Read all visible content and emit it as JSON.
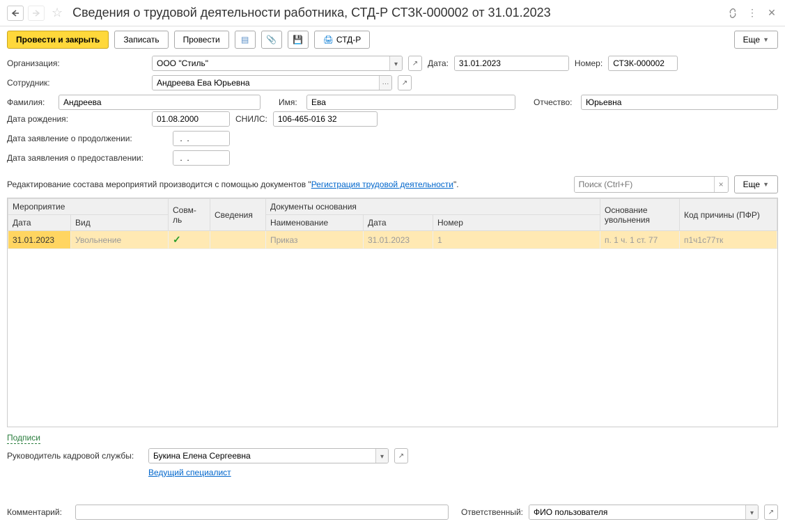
{
  "header": {
    "title": "Сведения о трудовой деятельности работника, СТД-Р СТЗК-000002 от 31.01.2023"
  },
  "toolbar": {
    "post_and_close": "Провести и закрыть",
    "save": "Записать",
    "post": "Провести",
    "std_r": "СТД-Р",
    "more": "Еще"
  },
  "fields": {
    "org_label": "Организация:",
    "org_value": "ООО \"Стиль\"",
    "date_label": "Дата:",
    "date_value": "31.01.2023",
    "number_label": "Номер:",
    "number_value": "СТЗК-000002",
    "employee_label": "Сотрудник:",
    "employee_value": "Андреева Ева Юрьевна",
    "lastname_label": "Фамилия:",
    "lastname_value": "Андреева",
    "firstname_label": "Имя:",
    "firstname_value": "Ева",
    "middlename_label": "Отчество:",
    "middlename_value": "Юрьевна",
    "birthdate_label": "Дата рождения:",
    "birthdate_value": "01.08.2000",
    "snils_label": "СНИЛС:",
    "snils_value": "106-465-016 32",
    "continue_label": "Дата заявление о продолжении:",
    "continue_value": " .  .    ",
    "provide_label": "Дата заявления о предоставлении:",
    "provide_value": " .  .    "
  },
  "hint": {
    "text_prefix": "Редактирование состава мероприятий производится с помощью документов \"",
    "link": "Регистрация трудовой деятельности",
    "text_suffix": "\".",
    "search_placeholder": "Поиск (Ctrl+F)",
    "more": "Еще"
  },
  "table": {
    "headers": {
      "event": "Мероприятие",
      "date": "Дата",
      "type": "Вид",
      "combine": "Совм-ль",
      "info": "Сведения",
      "docs": "Документы основания",
      "doc_name": "Наименование",
      "doc_date": "Дата",
      "doc_number": "Номер",
      "dismissal_basis": "Основание увольнения",
      "reason_code": "Код причины (ПФР)"
    },
    "rows": [
      {
        "date": "31.01.2023",
        "type": "Увольнение",
        "combine": "✓",
        "info": "",
        "doc_name": "Приказ",
        "doc_date": "31.01.2023",
        "doc_number": "1",
        "dismissal_basis": "п. 1 ч. 1 ст. 77",
        "reason_code": "п1ч1с77тк"
      }
    ]
  },
  "footer": {
    "signatures": "Подписи",
    "hr_head_label": "Руководитель кадровой службы:",
    "hr_head_value": "Букина Елена Сергеевна",
    "position_link": "Ведущий специалист",
    "comment_label": "Комментарий:",
    "responsible_label": "Ответственный:",
    "responsible_value": "ФИО пользователя"
  }
}
